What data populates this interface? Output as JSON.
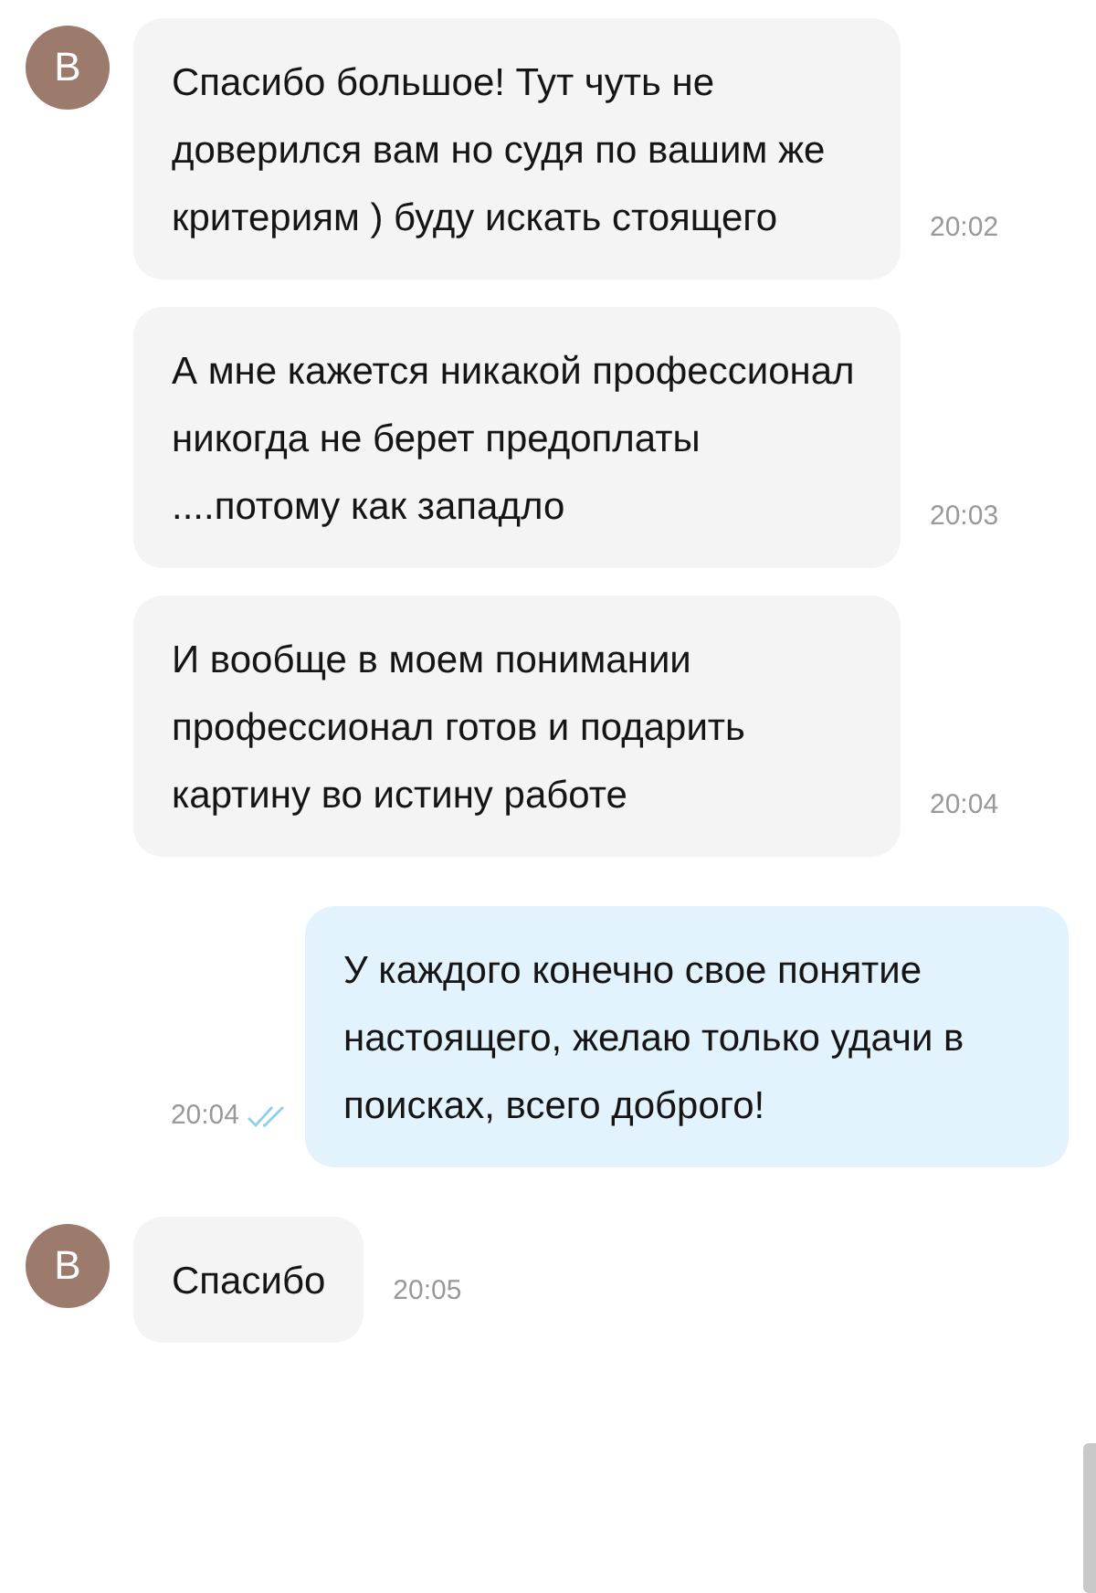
{
  "messages": [
    {
      "kind": "incoming",
      "avatar": "В",
      "text": "Спасибо большое! Тут чуть не доверился вам но судя по вашим же критериям ) буду искать стоящего",
      "time": "20:02"
    },
    {
      "kind": "incoming",
      "text": "А мне кажется никакой профессионал никогда не берет предоплаты ....потому как западло",
      "time": "20:03"
    },
    {
      "kind": "incoming",
      "text": "И вообще в моем понимании профессионал готов и подарить картину во истину работе",
      "time": "20:04"
    },
    {
      "kind": "outgoing",
      "text": "У каждого конечно свое понятие настоящего, желаю только удачи в поисках, всего доброго!",
      "time": "20:04",
      "read": true
    },
    {
      "kind": "incoming",
      "avatar": "В",
      "text": "Спасибо",
      "time": "20:05"
    }
  ]
}
